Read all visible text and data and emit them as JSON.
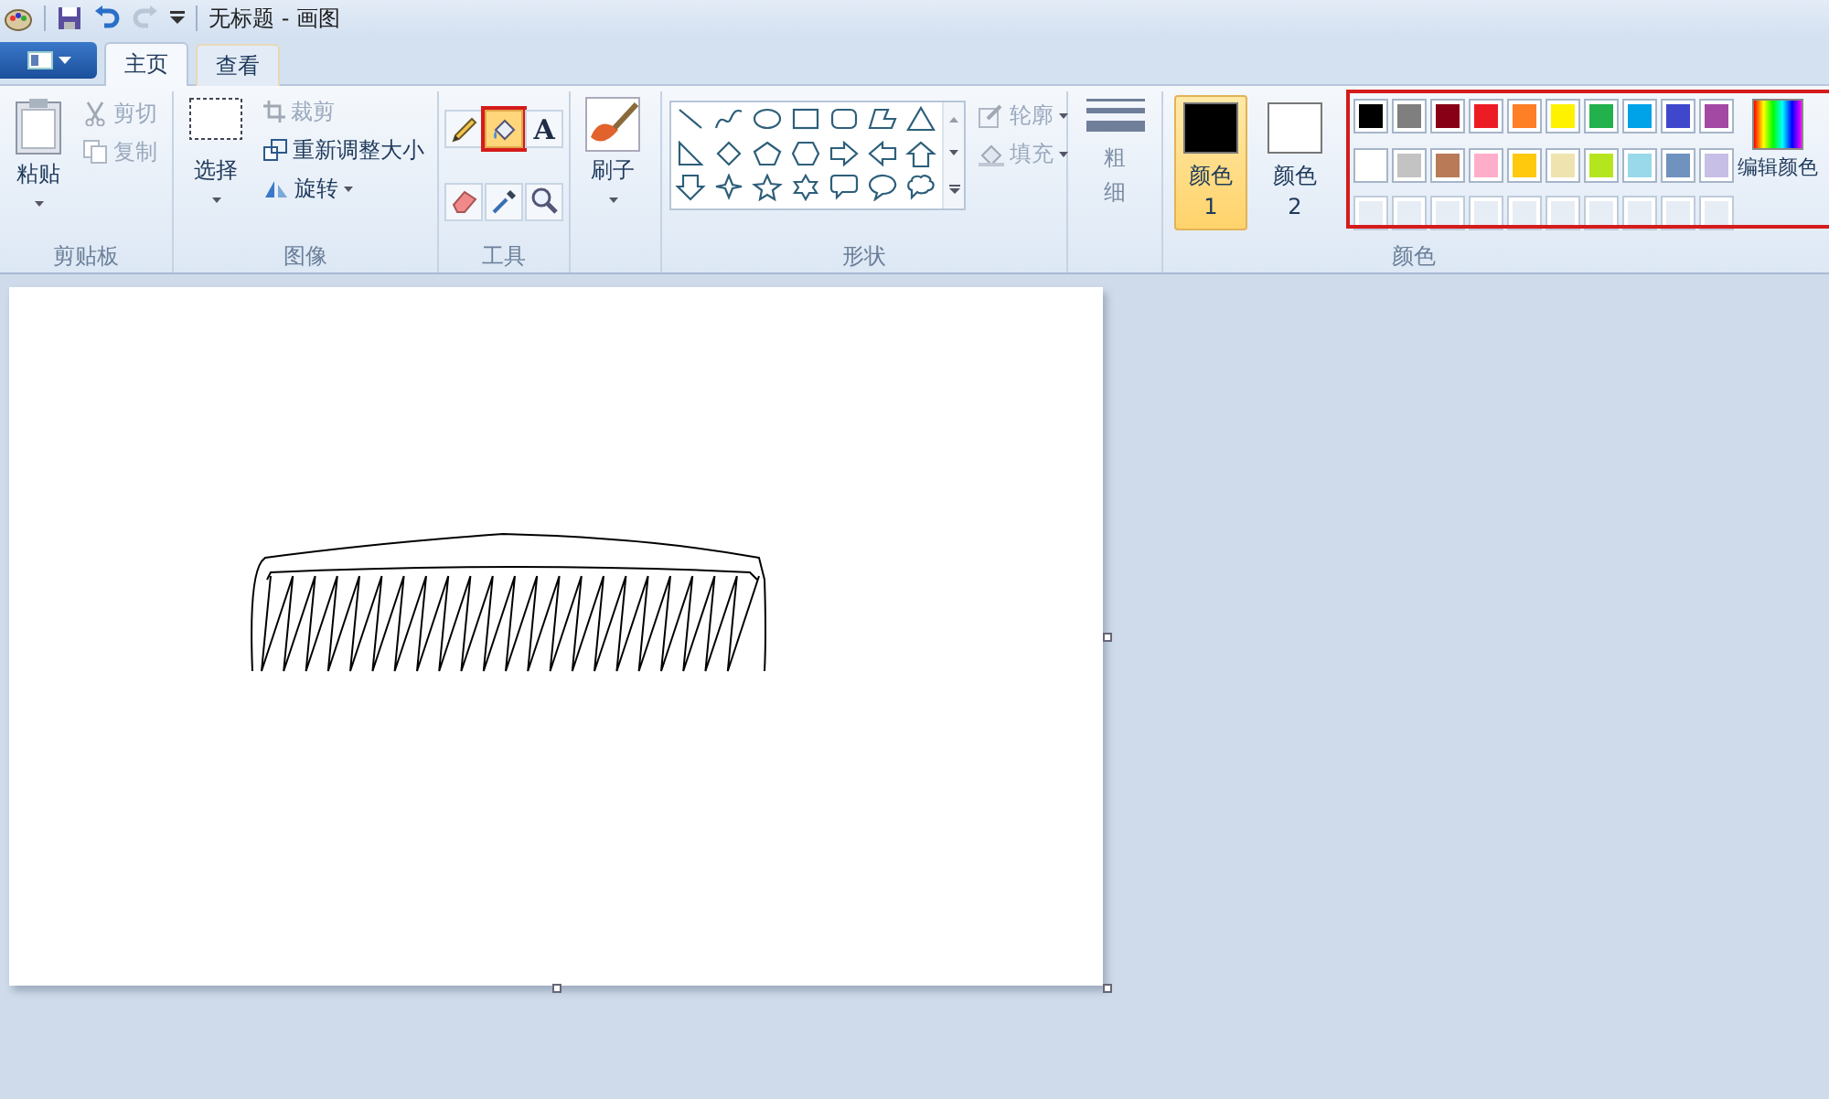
{
  "title_bar": {
    "title": "无标题 - 画图"
  },
  "tabs": [
    {
      "label": "主页",
      "selected": true
    },
    {
      "label": "查看",
      "selected": false
    }
  ],
  "clipboard": {
    "label": "剪贴板",
    "paste": "粘贴",
    "cut": {
      "label": "剪切",
      "disabled": true
    },
    "copy": {
      "label": "复制",
      "disabled": true
    }
  },
  "image": {
    "label": "图像",
    "select": "选择",
    "crop": {
      "label": "裁剪",
      "disabled": true
    },
    "resize": {
      "label": "重新调整大小",
      "disabled": false
    },
    "rotate": {
      "label": "旋转",
      "disabled": false
    }
  },
  "tools": {
    "label": "工具",
    "items": [
      {
        "kind": "pencil",
        "selected": false,
        "highlighted": false
      },
      {
        "kind": "fill",
        "selected": true,
        "highlighted": true
      },
      {
        "kind": "text",
        "glyph": "A",
        "selected": false,
        "highlighted": false
      },
      {
        "kind": "eraser",
        "selected": false,
        "highlighted": false
      },
      {
        "kind": "picker",
        "selected": false,
        "highlighted": false
      },
      {
        "kind": "magnifier",
        "selected": false,
        "highlighted": false
      }
    ]
  },
  "brushes": {
    "label": "刷子"
  },
  "shapes": {
    "label": "形状",
    "outline": {
      "label": "轮廓",
      "disabled": true
    },
    "fill": {
      "label": "填充",
      "disabled": true
    }
  },
  "size": {
    "label": "粗细"
  },
  "color1": {
    "label": "颜色 1",
    "color": "#000000",
    "selected": true
  },
  "color2": {
    "label": "颜色 2",
    "color": "#ffffff",
    "selected": false
  },
  "colors": {
    "label": "颜色",
    "highlighted": true,
    "edit": "编辑颜色",
    "palette": [
      {
        "color": "#000000"
      },
      {
        "color": "#7f7f7f"
      },
      {
        "color": "#880015"
      },
      {
        "color": "#ed1c24"
      },
      {
        "color": "#ff7f27"
      },
      {
        "color": "#fff200"
      },
      {
        "color": "#22b14c"
      },
      {
        "color": "#00a2e8"
      },
      {
        "color": "#3f48cc"
      },
      {
        "color": "#a349a4"
      },
      {
        "color": "#ffffff"
      },
      {
        "color": "#c3c3c3"
      },
      {
        "color": "#b97a57"
      },
      {
        "color": "#ffaec9"
      },
      {
        "color": "#ffc90e"
      },
      {
        "color": "#efe4b0"
      },
      {
        "color": "#b5e61d"
      },
      {
        "color": "#99d9ea"
      },
      {
        "color": "#7092be"
      },
      {
        "color": "#c8bfe7"
      }
    ]
  }
}
